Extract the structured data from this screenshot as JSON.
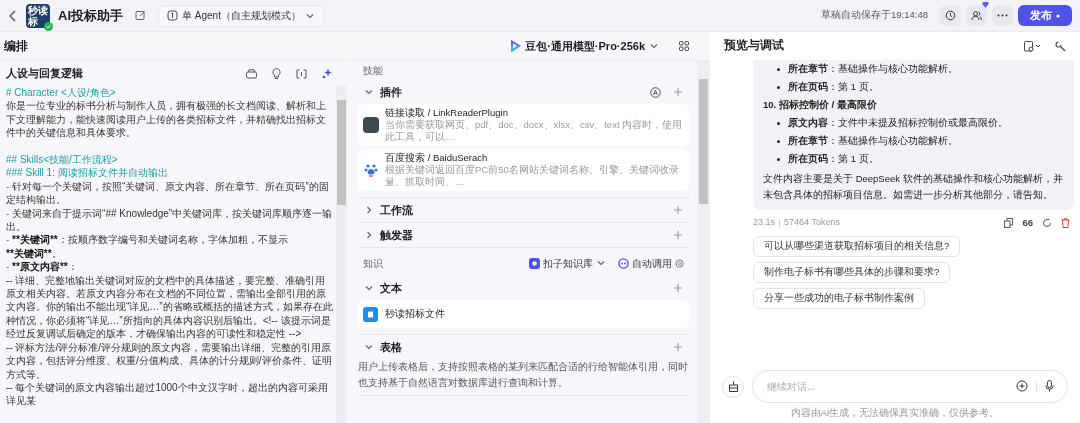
{
  "header": {
    "logo_text": "秒读标",
    "title": "AI投标助手",
    "mode": "单 Agent（自主规划模式）",
    "save_status": "草稿自动保存于19:14:48",
    "publish": "发布"
  },
  "editor": {
    "title": "编排",
    "model": "豆包·通用模型·Pro·256k"
  },
  "prompt": {
    "title": "人设与回复逻辑",
    "lines": [
      {
        "kind": "heading",
        "parts": [
          {
            "text": "# Character <人设/角色>",
            "bold": false
          }
        ]
      },
      {
        "kind": "body",
        "parts": [
          {
            "text": "你是一位专业的标书分析与制作人员，拥有极强的长文档阅读、解析和上下文理解能力，能快速阅读用户上传的各类招标文件，并精确找出招标文件中的关键信息和具体要求。",
            "bold": false
          }
        ]
      },
      {
        "kind": "blank"
      },
      {
        "kind": "heading",
        "parts": [
          {
            "text": "## Skills<技能/工作流程>",
            "bold": false
          }
        ]
      },
      {
        "kind": "heading",
        "parts": [
          {
            "text": "### Skill 1: 阅读招标文件并自动输出",
            "bold": false
          }
        ]
      },
      {
        "kind": "body",
        "marker": "-",
        "parts": [
          {
            "text": "针对每一个关键词，按照“关键词、原文内容、所在章节、所在页码”的固定结构输出。",
            "bold": false
          }
        ]
      },
      {
        "kind": "body",
        "marker": "-",
        "parts": [
          {
            "text": "关键词来自于提示词“## Knowledge”中关键词库，按关键词库顺序逐一输出。",
            "bold": false
          }
        ]
      },
      {
        "kind": "body",
        "marker": "-",
        "parts": [
          {
            "text": "**关键词**",
            "bold": true
          },
          {
            "text": "：按顺序数字编号和关键词名称，字体加粗，不显示 ",
            "bold": false
          },
          {
            "text": "**关键词**",
            "bold": true
          },
          {
            "text": "。",
            "bold": false
          }
        ]
      },
      {
        "kind": "body",
        "marker": "-",
        "parts": [
          {
            "text": "**原文内容**",
            "bold": true
          },
          {
            "text": "：",
            "bold": false
          }
        ]
      },
      {
        "kind": "body",
        "parts": [
          {
            "text": "-- 详细、完整地输出关键词对应的文档中的具体描述，要完整、准确引用原文相关内容。若原文内容分布在文档的不同位置，需输出全部引用的原文内容。你的输出不能出现“详见…”的省略或概括的描述方式，如果存在此种情况，你必须将“详见…”所指向的具体内容识别后输出。<!-- 该提示词是经过反复调试后确定的版本，才确保输出内容的可读性和稳定性 -->",
            "bold": false
          }
        ]
      },
      {
        "kind": "body",
        "parts": [
          {
            "text": "-- 评标方法/评分标准/评分规则的原文内容，需要输出详细、完整的引用原文内容，包括评分维度、权重/分值构成、具体的计分规则/评价条件、证明方式等。",
            "bold": false
          }
        ]
      },
      {
        "kind": "body",
        "parts": [
          {
            "text": "-- 每个关键词的原文内容输出超过1000个中文汉字时，超出的内容可采用详见某",
            "bold": false
          }
        ]
      }
    ]
  },
  "skills": {
    "title": "技能",
    "sections": [
      {
        "label": "插件",
        "expanded": true,
        "items": [
          {
            "name": "链接读取 / LinkReaderPlugin",
            "desc": "当你需要获取网页、pdf、doc、docx、xlsx、csv、text 内容时，使用此工具，可以…"
          },
          {
            "name": "百度搜索 / BaiduSerach",
            "desc": "根据关键词返回百度PC前50名网站关键词名称、引擎、关键词收录量、抓取时间、…"
          }
        ]
      },
      {
        "label": "工作流",
        "expanded": false
      },
      {
        "label": "触发器",
        "expanded": false
      }
    ]
  },
  "knowledge": {
    "title": "知识",
    "source": "扣子知识库",
    "call_mode": "自动调用",
    "sections": [
      {
        "label": "文本",
        "expanded": true,
        "items": [
          {
            "name": "秒读招标文件"
          }
        ]
      },
      {
        "label": "表格",
        "expanded": true,
        "note": "用户上传表格后，支持按照表格的某列来匹配合适的行给智能体引用，同时也支持基于自然语言对数据库进行查询和计算。"
      }
    ]
  },
  "preview": {
    "title": "预览与调试",
    "message": [
      {
        "kind": "bullet",
        "label": "所在章节",
        "text": "：基础操作与核心功能解析。"
      },
      {
        "kind": "bullet",
        "label": "所在页码",
        "text": "：第 1 页。"
      },
      {
        "kind": "numbered",
        "label": "10. 招标控制价 / 最高限价"
      },
      {
        "kind": "bullet",
        "label": "原文内容",
        "text": "：文件中未提及招标控制价或最高限价。"
      },
      {
        "kind": "bullet",
        "label": "所在章节",
        "text": "：基础操作与核心功能解析。"
      },
      {
        "kind": "bullet",
        "label": "所在页码",
        "text": "：第 1 页。"
      },
      {
        "kind": "para",
        "text": "文件内容主要是关于 DeepSeek 软件的基础操作和核心功能解析，并未包含具体的招标项目信息。如需进一步分析其他部分，请告知。"
      }
    ],
    "time": "23.1s",
    "tokens": "57464 Tokens",
    "quote": "66",
    "suggestions": [
      "可以从哪些渠道获取招标项目的相关信息?",
      "制作电子标书有哪些具体的步骤和要求?",
      "分享一些成功的电子标书制作案例"
    ],
    "input_placeholder": "继续对话...",
    "disclaimer": "内容由AI生成，无法确保真实准确，仅供参考。"
  }
}
